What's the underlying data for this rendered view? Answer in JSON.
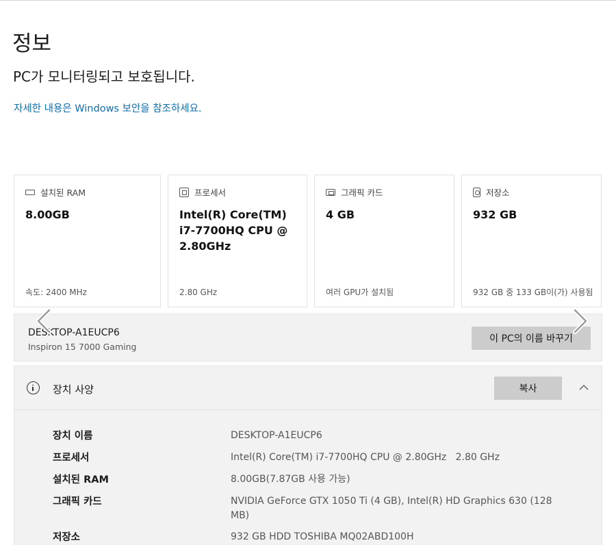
{
  "page": {
    "title": "정보",
    "status": "PC가 모니터링되고 보호됩니다.",
    "security_link": "자세한 내용은 Windows 보안을 참조하세요."
  },
  "cards": [
    {
      "icon": "ram-icon",
      "label": "설치된 RAM",
      "value": "8.00GB",
      "sub": "속도: 2400 MHz"
    },
    {
      "icon": "processor-icon",
      "label": "프로세서",
      "value": "Intel(R) Core(TM) i7-7700HQ CPU @ 2.80GHz",
      "sub": "2.80 GHz"
    },
    {
      "icon": "graphics-card-icon",
      "label": "그래픽 카드",
      "value": "4 GB",
      "sub": "여러 GPU가 설치됨"
    },
    {
      "icon": "storage-icon",
      "label": "저장소",
      "value": "932 GB",
      "sub": "932 GB 중 133 GB이(가) 사용됨"
    }
  ],
  "device": {
    "name": "DESKTOP-A1EUCP6",
    "model": "Inspiron 15 7000 Gaming",
    "rename_label": "이 PC의 이름 바꾸기"
  },
  "specs": {
    "title": "장치 사양",
    "copy_label": "복사",
    "rows": [
      {
        "label": "장치 이름",
        "value": "DESKTOP-A1EUCP6"
      },
      {
        "label": "프로세서",
        "value": "Intel(R) Core(TM) i7-7700HQ CPU @ 2.80GHz   2.80 GHz"
      },
      {
        "label": "설치된 RAM",
        "value": "8.00GB(7.87GB 사용 가능)"
      },
      {
        "label": "그래픽 카드",
        "value": "NVIDIA GeForce GTX 1050 Ti (4 GB), Intel(R) HD Graphics 630 (128 MB)"
      },
      {
        "label": "저장소",
        "value": "932 GB HDD TOSHIBA MQ02ABD100H"
      }
    ]
  },
  "colors": {
    "link": "#0b6fb0",
    "button": "#cccccc",
    "panel": "#f2f2f2"
  }
}
